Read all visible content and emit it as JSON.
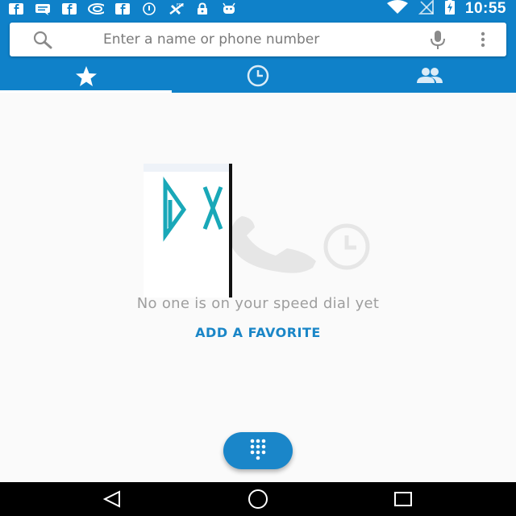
{
  "status_bar": {
    "time": "10:55",
    "left_icons": [
      "facebook-icon",
      "message-icon",
      "facebook-icon",
      "nvidia-icon",
      "facebook-icon",
      "info-icon",
      "no-signal-icon",
      "lock-icon",
      "android-icon"
    ],
    "right_icons": [
      "wifi-icon",
      "no-sim-icon",
      "battery-charging-icon"
    ]
  },
  "search": {
    "placeholder": "Enter a name or phone number"
  },
  "tabs": [
    {
      "icon": "star-icon",
      "name": "speed-dial",
      "active": true
    },
    {
      "icon": "clock-icon",
      "name": "recents",
      "active": false
    },
    {
      "icon": "people-icon",
      "name": "contacts",
      "active": false
    }
  ],
  "empty_state": {
    "message": "No one is on your speed dial yet",
    "action_label": "ADD A FAVORITE",
    "overlay_logo_text": "DX"
  },
  "fab": {
    "icon": "dialpad-icon"
  },
  "nav": [
    "back-icon",
    "home-icon",
    "recents-icon"
  ],
  "colors": {
    "primary": "#0f81c9",
    "accent": "#1a86c7",
    "background": "#fafafa",
    "muted_text": "#9e9e9e"
  }
}
